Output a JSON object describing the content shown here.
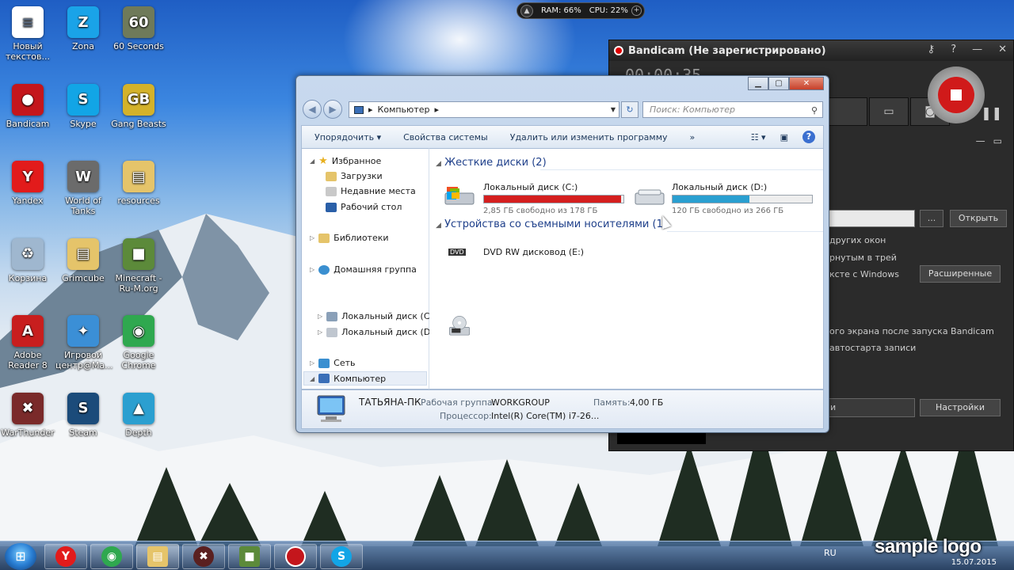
{
  "desktop": {
    "icons": [
      {
        "label": "Новый текстов...",
        "glyph": "≡",
        "color": "#ffffff"
      },
      {
        "label": "Zona",
        "glyph": "Z",
        "color": "#1aa3e8"
      },
      {
        "label": "60 Seconds",
        "glyph": "60",
        "color": "#6f7a5a"
      },
      {
        "label": "Bandicam",
        "glyph": "●",
        "color": "#c4161c"
      },
      {
        "label": "Skype",
        "glyph": "S",
        "color": "#12a5e6"
      },
      {
        "label": "Gang Beasts",
        "glyph": "GB",
        "color": "#d4b22a"
      },
      {
        "label": "Yandex",
        "glyph": "Y",
        "color": "#e21b1b"
      },
      {
        "label": "World of Tanks",
        "glyph": "W",
        "color": "#6b6b6b"
      },
      {
        "label": "resources",
        "glyph": "▤",
        "color": "#e5c46a"
      },
      {
        "label": "Корзина",
        "glyph": "♻",
        "color": "#9fb7cf"
      },
      {
        "label": "Grimcube",
        "glyph": "▤",
        "color": "#e5c46a"
      },
      {
        "label": "Minecraft - Ru-M.org",
        "glyph": "■",
        "color": "#5c8a3a"
      },
      {
        "label": "Adobe Reader 8",
        "glyph": "A",
        "color": "#c81e1e"
      },
      {
        "label": "Игровой центр@Ma...",
        "glyph": "✦",
        "color": "#3b8fd6"
      },
      {
        "label": "Google Chrome",
        "glyph": "◉",
        "color": "#2fa84f"
      },
      {
        "label": "WarThunder",
        "glyph": "✖",
        "color": "#7a2a2a"
      },
      {
        "label": "Steam",
        "glyph": "S",
        "color": "#1b4b7a"
      },
      {
        "label": "Depth",
        "glyph": "▲",
        "color": "#2b9fd0"
      }
    ]
  },
  "resmon": {
    "ram": "RAM: 66%",
    "cpu": "CPU: 22%"
  },
  "bandicam": {
    "title": "Bandicam (Не зарегистрировано)",
    "timer": "00:00:35",
    "open_btn": "Открыть",
    "dots_btn": "...",
    "advanced_btn": "Расширенные",
    "settings_btn": "Настройки",
    "bottom_field": "и",
    "options": [
      "других окон",
      "рнутым в трей",
      "ксте с Windows",
      "ого экрана после запуска Bandicam",
      "автостарта записи"
    ]
  },
  "explorer": {
    "address": "Компьютер",
    "search_placeholder": "Поиск: Компьютер",
    "commands": [
      "Упорядочить ▾",
      "Свойства системы",
      "Удалить или изменить программу",
      "»"
    ],
    "nav": {
      "favorites": "Избранное",
      "downloads": "Загрузки",
      "recent": "Недавние места",
      "desktop": "Рабочий стол",
      "libraries": "Библиотеки",
      "homegroup": "Домашняя группа",
      "computer": "Компьютер",
      "disk_c": "Локальный диск (C:)",
      "disk_d": "Локальный диск (D:)",
      "network": "Сеть"
    },
    "groups": {
      "hard_disks": "Жесткие диски (2)",
      "removable": "Устройства со съемными носителями (1)"
    },
    "drives": [
      {
        "name": "Локальный диск (C:)",
        "free": "2,85 ГБ свободно из 178 ГБ",
        "used_fraction": 0.984,
        "color": "#d41f1f"
      },
      {
        "name": "Локальный диск (D:)",
        "free": "120 ГБ свободно из 266 ГБ",
        "used_fraction": 0.55,
        "color": "#2a9fd0"
      }
    ],
    "dvd": {
      "name": "DVD RW дисковод (E:)",
      "label": "DVD"
    },
    "details": {
      "pc_name": "ТАТЬЯНА-ПК",
      "workgroup_label": "Рабочая группа:",
      "workgroup": "WORKGROUP",
      "memory_label": "Память:",
      "memory": "4,00 ГБ",
      "cpu_label": "Процессор:",
      "cpu": "Intel(R) Core(TM) i7-26..."
    }
  },
  "taskbar": {
    "lang": "RU",
    "date": "15.07.2015",
    "logo": "sample logo"
  }
}
